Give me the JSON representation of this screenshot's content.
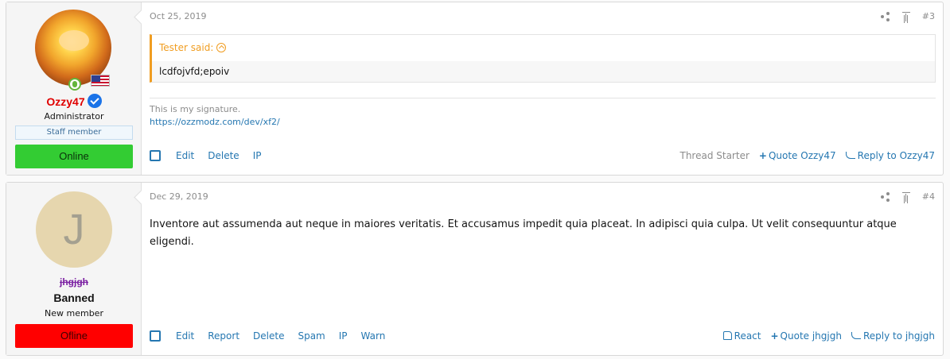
{
  "posts": [
    {
      "user": {
        "name": "Ozzy47",
        "title": "Administrator",
        "badge": "Staff member",
        "presence": "Online"
      },
      "date": "Oct 25, 2019",
      "post_number": "#3",
      "quote": {
        "author": "Tester said:",
        "text": "lcdfojvfd;epoiv"
      },
      "signature": {
        "text": "This is my signature.",
        "link": "https://ozzmodz.com/dev/xf2/"
      },
      "actions_left": [
        "Edit",
        "Delete",
        "IP"
      ],
      "thread_starter": "Thread Starter",
      "quote_action": "Quote Ozzy47",
      "reply_action": "Reply to Ozzy47"
    },
    {
      "user": {
        "avatar_letter": "J",
        "name": "jhgjgh",
        "status": "Banned",
        "title": "New member",
        "presence": "Ofline"
      },
      "date": "Dec 29, 2019",
      "post_number": "#4",
      "message": "Inventore aut assumenda aut neque in maiores veritatis. Et accusamus impedit quia placeat. In adipisci quia culpa. Ut velit consequuntur atque eligendi.",
      "actions_left": [
        "Edit",
        "Report",
        "Delete",
        "Spam",
        "IP",
        "Warn"
      ],
      "react_action": "React",
      "quote_action": "Quote jhgjgh",
      "reply_action": "Reply to jhgjgh"
    }
  ],
  "colors": {
    "link": "#2577b1",
    "online": "#33cc33",
    "offline": "#ff0000",
    "admin_name": "#e00000",
    "banned_name": "#7b1fa2",
    "quote_accent": "#f09d21"
  },
  "icons": [
    "share-icon",
    "jump-to-top-icon",
    "quote-up-icon",
    "verified-icon",
    "online-status-icon",
    "us-flag-icon",
    "checkbox-icon",
    "plus-icon",
    "reply-icon",
    "thumbs-up-icon"
  ]
}
